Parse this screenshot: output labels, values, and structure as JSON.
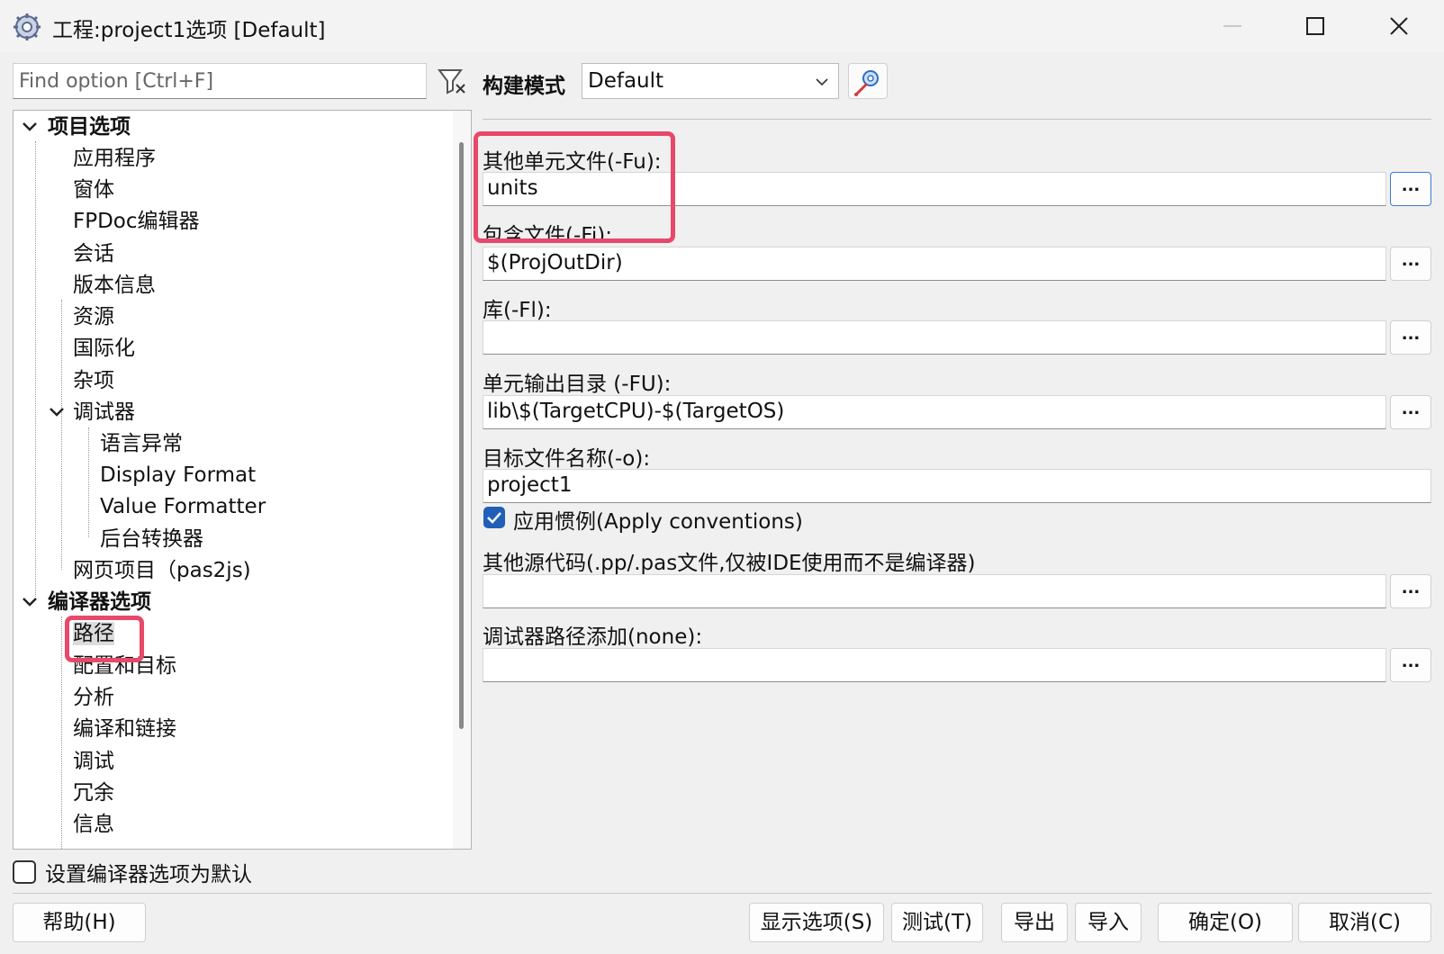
{
  "window": {
    "title": "工程:project1选项 [Default]",
    "icons": [
      "app-gear-icon",
      "minimize-icon",
      "maximize-icon",
      "close-icon"
    ]
  },
  "search": {
    "placeholder": "Find option [Ctrl+F]",
    "filter_icon": "filter-clear-icon"
  },
  "tree": {
    "project_options": {
      "label": "项目选项",
      "items": [
        "应用程序",
        "窗体",
        "FPDoc编辑器",
        "会话",
        "版本信息",
        "资源",
        "国际化",
        "杂项"
      ],
      "debugger": {
        "label": "调试器",
        "items": [
          "语言异常",
          "Display Format",
          "Value Formatter",
          "后台转换器"
        ]
      },
      "web_project": "网页项目（pas2js)"
    },
    "compiler_options": {
      "label": "编译器选项",
      "selected": "路径",
      "items": [
        "路径",
        "配置和目标",
        "分析",
        "编译和链接",
        "调试",
        "冗余",
        "信息"
      ]
    }
  },
  "set_default": {
    "label": "设置编译器选项为默认",
    "checked": false
  },
  "build_mode": {
    "label": "构建模式",
    "value": "Default",
    "tool_icon": "build-mode-settings-icon"
  },
  "fields": {
    "other_units": {
      "label": "其他单元文件(-Fu):",
      "value": "units"
    },
    "include_files": {
      "label": "包含文件(-Fi):",
      "value": "$(ProjOutDir)"
    },
    "libraries": {
      "label": "库(-Fl):",
      "value": ""
    },
    "unit_output": {
      "label": "单元输出目录 (-FU):",
      "value": "lib\\$(TargetCPU)-$(TargetOS)"
    },
    "target_file": {
      "label": "目标文件名称(-o):",
      "value": "project1"
    },
    "apply_conventions": {
      "label": "应用惯例(Apply conventions)",
      "checked": true
    },
    "other_sources": {
      "label": "其他源代码(.pp/.pas文件,仅被IDE使用而不是编译器)",
      "value": ""
    },
    "debugger_path": {
      "label": "调试器路径添加(none):",
      "value": ""
    },
    "browse_label": "..."
  },
  "buttons": {
    "help": "帮助(H)",
    "show_options": "显示选项(S)",
    "test": "测试(T)",
    "export": "导出",
    "import": "导入",
    "ok": "确定(O)",
    "cancel": "取消(C)"
  },
  "colors": {
    "highlight": "#e8486a",
    "checkbox_checked": "#1f5fb8"
  }
}
